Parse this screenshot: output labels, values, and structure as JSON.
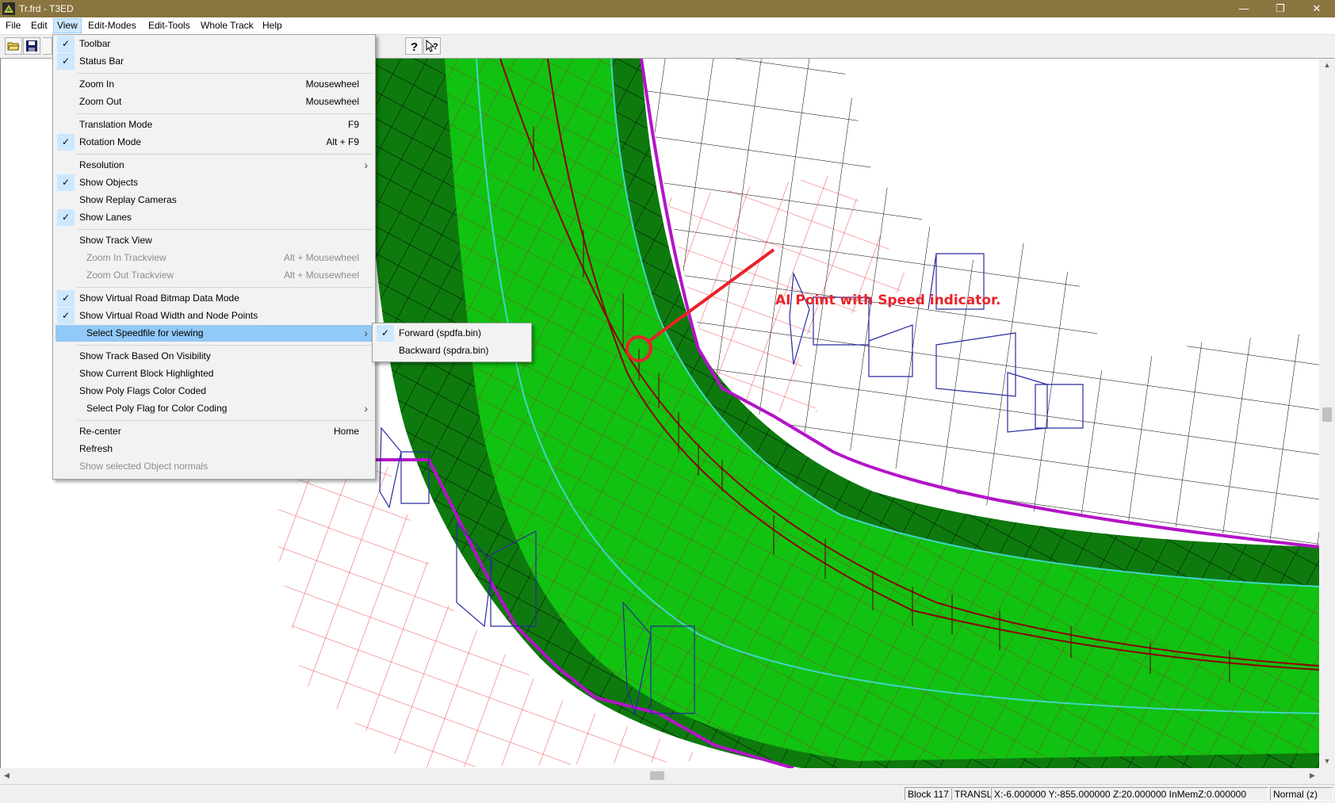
{
  "window": {
    "title": "Tr.frd - T3ED",
    "minimize": "—",
    "maximize": "❐",
    "close": "✕"
  },
  "menubar": [
    "File",
    "Edit",
    "View",
    "Edit-Modes",
    "Edit-Tools",
    "Whole Track",
    "Help"
  ],
  "menubar_active": "View",
  "colors": {
    "titlebar": "#8a7540",
    "road_light": "#11c211",
    "road_dark": "#0e7a0e",
    "mesh_red": "#e8232a",
    "boundary_magenta": "#b314c8",
    "objects_blue": "#2a2aa0",
    "lane_cyan": "#3fd6c6"
  },
  "toolbar": {
    "icons": [
      "open-icon",
      "save-icon",
      "help-icon",
      "context-help-icon"
    ]
  },
  "view_menu": {
    "toolbar": "Toolbar",
    "status_bar": "Status Bar",
    "zoom_in": "Zoom In",
    "zoom_in_acc": "Mousewheel",
    "zoom_out": "Zoom Out",
    "zoom_out_acc": "Mousewheel",
    "translation_mode": "Translation Mode",
    "translation_mode_acc": "F9",
    "rotation_mode": "Rotation Mode",
    "rotation_mode_acc": "Alt + F9",
    "resolution": "Resolution",
    "show_objects": "Show Objects",
    "show_replay_cameras": "Show Replay Cameras",
    "show_lanes": "Show Lanes",
    "show_track_view": "Show Track View",
    "zoom_in_trackview": "Zoom In Trackview",
    "zoom_in_trackview_acc": "Alt + Mousewheel",
    "zoom_out_trackview": "Zoom Out Trackview",
    "zoom_out_trackview_acc": "Alt + Mousewheel",
    "show_vroad_bitmap": "Show Virtual Road Bitmap Data Mode",
    "show_vroad_width": "Show Virtual Road Width and Node Points",
    "select_speedfile": "Select Speedfile for viewing",
    "show_track_visibility": "Show Track Based On Visibility",
    "show_current_block": "Show Current Block Highlighted",
    "show_poly_flags": "Show Poly Flags Color Coded",
    "select_poly_flag": "Select Poly Flag for Color Coding",
    "recenter": "Re-center",
    "recenter_acc": "Home",
    "refresh": "Refresh",
    "show_object_normals": "Show selected Object normals",
    "check": "✓",
    "submenu_arrow": "›"
  },
  "speed_submenu": {
    "forward": "Forward (spdfa.bin)",
    "backward": "Backward (spdra.bin)"
  },
  "annotation": "AI Point with Speed indicator.",
  "statusbar": {
    "block": "Block 117",
    "mode": "TRANSL",
    "coords": "X:-6.000000 Y:-855.000000 Z:20.000000 InMemZ:0.000000",
    "view": "Normal (z)"
  }
}
